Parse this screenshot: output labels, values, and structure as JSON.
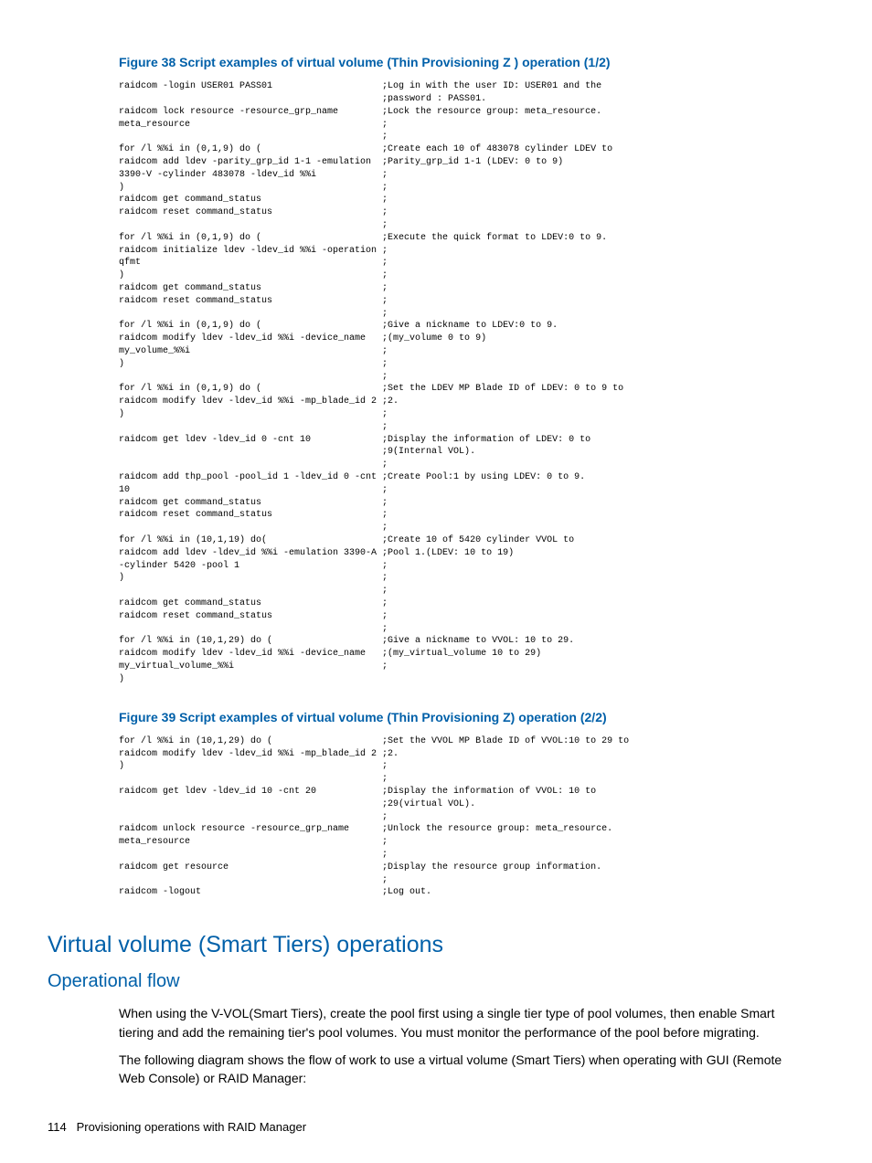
{
  "figure38": {
    "title": "Figure 38 Script examples of virtual volume (Thin Provisioning Z ) operation (1/2)",
    "lines": [
      {
        "l": "raidcom -login USER01 PASS01",
        "r": ";Log in with the user ID: USER01 and the"
      },
      {
        "l": "",
        "r": ";password : PASS01."
      },
      {
        "l": "raidcom lock resource -resource_grp_name",
        "r": ";Lock the resource group: meta_resource."
      },
      {
        "l": "meta_resource",
        "r": ";"
      },
      {
        "l": "",
        "r": ";"
      },
      {
        "l": "for /l %%i in (0,1,9) do (",
        "r": ";Create each 10 of 483078 cylinder LDEV to"
      },
      {
        "l": "raidcom add ldev -parity_grp_id 1-1 -emulation",
        "r": ";Parity_grp_id 1-1 (LDEV: 0 to 9)"
      },
      {
        "l": "3390-V -cylinder 483078 -ldev_id %%i",
        "r": ";"
      },
      {
        "l": ")",
        "r": ";"
      },
      {
        "l": "raidcom get command_status",
        "r": ";"
      },
      {
        "l": "raidcom reset command_status",
        "r": ";"
      },
      {
        "l": "",
        "r": ";"
      },
      {
        "l": "for /l %%i in (0,1,9) do (",
        "r": ";Execute the quick format to LDEV:0 to 9."
      },
      {
        "l": "raidcom initialize ldev -ldev_id %%i -operation",
        "r": ";"
      },
      {
        "l": "qfmt",
        "r": ";"
      },
      {
        "l": ")",
        "r": ";"
      },
      {
        "l": "raidcom get command_status",
        "r": ";"
      },
      {
        "l": "raidcom reset command_status",
        "r": ";"
      },
      {
        "l": "",
        "r": ";"
      },
      {
        "l": "for /l %%i in (0,1,9) do (",
        "r": ";Give a nickname to LDEV:0 to 9."
      },
      {
        "l": "raidcom modify ldev -ldev_id %%i -device_name",
        "r": ";(my_volume 0 to 9)"
      },
      {
        "l": "my_volume_%%i",
        "r": ";"
      },
      {
        "l": ")",
        "r": ";"
      },
      {
        "l": "",
        "r": ";"
      },
      {
        "l": "for /l %%i in (0,1,9) do (",
        "r": ";Set the LDEV MP Blade ID of LDEV: 0 to 9 to"
      },
      {
        "l": "raidcom modify ldev -ldev_id %%i -mp_blade_id 2",
        "r": ";2."
      },
      {
        "l": ")",
        "r": ";"
      },
      {
        "l": "",
        "r": ";"
      },
      {
        "l": "raidcom get ldev -ldev_id 0 -cnt 10",
        "r": ";Display the information of LDEV: 0 to"
      },
      {
        "l": "",
        "r": ";9(Internal VOL)."
      },
      {
        "l": "",
        "r": ";"
      },
      {
        "l": "raidcom add thp_pool -pool_id 1 -ldev_id 0 -cnt",
        "r": ";Create Pool:1 by using LDEV: 0 to 9."
      },
      {
        "l": "10",
        "r": ";"
      },
      {
        "l": "raidcom get command_status",
        "r": ";"
      },
      {
        "l": "raidcom reset command_status",
        "r": ";"
      },
      {
        "l": "",
        "r": ";"
      },
      {
        "l": "for /l %%i in (10,1,19) do(",
        "r": ";Create 10 of 5420 cylinder VVOL to"
      },
      {
        "l": "raidcom add ldev -ldev_id %%i -emulation 3390-A",
        "r": ";Pool 1.(LDEV: 10 to 19)"
      },
      {
        "l": "-cylinder 5420 -pool 1",
        "r": ";"
      },
      {
        "l": ")",
        "r": ";"
      },
      {
        "l": "",
        "r": ";"
      },
      {
        "l": "raidcom get command_status",
        "r": ";"
      },
      {
        "l": "raidcom reset command_status",
        "r": ";"
      },
      {
        "l": "",
        "r": ";"
      },
      {
        "l": "for /l %%i in (10,1,29) do (",
        "r": ";Give a nickname to VVOL: 10 to 29."
      },
      {
        "l": "raidcom modify ldev -ldev_id %%i -device_name",
        "r": ";(my_virtual_volume 10 to 29)"
      },
      {
        "l": "my_virtual_volume_%%i",
        "r": ";"
      },
      {
        "l": ")",
        "r": ""
      }
    ]
  },
  "figure39": {
    "title": "Figure 39 Script examples of virtual volume (Thin Provisioning Z) operation (2/2)",
    "lines": [
      {
        "l": "for /l %%i in (10,1,29) do (",
        "r": ";Set the VVOL MP Blade ID of VVOL:10 to 29 to"
      },
      {
        "l": "raidcom modify ldev -ldev_id %%i -mp_blade_id 2",
        "r": ";2."
      },
      {
        "l": ")",
        "r": ";"
      },
      {
        "l": "",
        "r": ";"
      },
      {
        "l": "raidcom get ldev -ldev_id 10 -cnt 20",
        "r": ";Display the information of VVOL: 10 to"
      },
      {
        "l": "",
        "r": ";29(virtual VOL)."
      },
      {
        "l": "",
        "r": ";"
      },
      {
        "l": "raidcom unlock resource -resource_grp_name",
        "r": ";Unlock the resource group: meta_resource."
      },
      {
        "l": "meta_resource",
        "r": ";"
      },
      {
        "l": "",
        "r": ";"
      },
      {
        "l": "raidcom get resource",
        "r": ";Display the resource group information."
      },
      {
        "l": "",
        "r": ";"
      },
      {
        "l": "raidcom -logout",
        "r": ";Log out."
      }
    ]
  },
  "h1": "Virtual volume (Smart Tiers) operations",
  "h2": "Operational flow",
  "para1": "When using the V-VOL(Smart Tiers), create the pool first using a single tier type of pool volumes, then enable Smart tiering and add the remaining tier's pool volumes. You must monitor the performance of the pool before migrating.",
  "para2": "The following diagram shows the flow of work to use a virtual volume (Smart Tiers) when operating with GUI (Remote Web Console) or RAID Manager:",
  "footer": {
    "page": "114",
    "label": "Provisioning operations with RAID Manager"
  }
}
